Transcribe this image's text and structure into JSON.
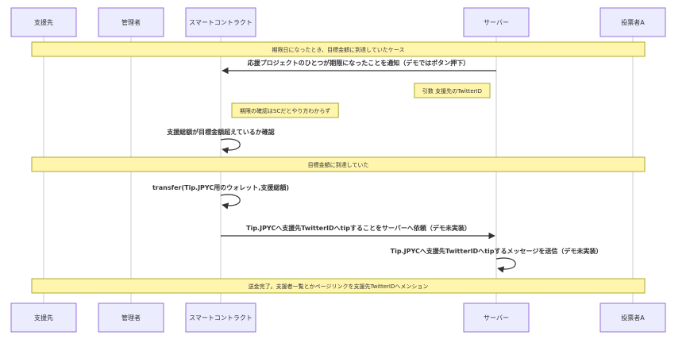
{
  "actors": [
    {
      "id": "supported",
      "label": "支援先"
    },
    {
      "id": "admin",
      "label": "管理者"
    },
    {
      "id": "contract",
      "label": "スマートコントラクト"
    },
    {
      "id": "server",
      "label": "サーバー"
    },
    {
      "id": "investor",
      "label": "投票者A"
    }
  ],
  "items": [
    {
      "kind": "banner",
      "text": "期限日になったとき、目標金額に到達していたケース"
    },
    {
      "kind": "message",
      "from": "server",
      "to": "contract",
      "text": "応援プロジェクトのひとつが期限になったことを通知（デモではボタン押下）"
    },
    {
      "kind": "note",
      "over": "server",
      "side": "left",
      "text": "引数 支援先のTwitterID"
    },
    {
      "kind": "note",
      "over": "contract",
      "side": "right",
      "text": "期限の確認はSCだとやり方わからず"
    },
    {
      "kind": "self",
      "actor": "contract",
      "text": "支援総額が目標金額超えているか確認"
    },
    {
      "kind": "banner",
      "text": "目標金額に到達していた"
    },
    {
      "kind": "self",
      "actor": "contract",
      "text": "transfer(Tip.JPYC用のウォレット,支援総額)"
    },
    {
      "kind": "message",
      "from": "contract",
      "to": "server",
      "text": "Tip.JPYCへ支援先TwitterIDへtipすることをサーバーへ依頼（デモ未実装）"
    },
    {
      "kind": "self",
      "actor": "server",
      "text": "Tip.JPYCへ支援先TwitterIDへtipするメッセージを送信（デモ未実装）"
    },
    {
      "kind": "banner",
      "text": "送金完了。支援者一覧とかページリンクを支援先TwitterIDへメンション"
    }
  ]
}
